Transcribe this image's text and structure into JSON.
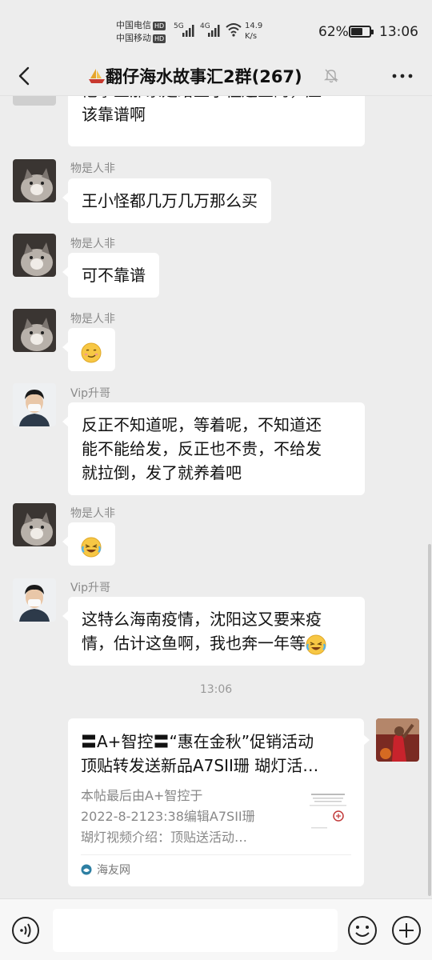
{
  "status": {
    "carrier1": "中国电信",
    "carrier2": "中国移动",
    "hd": "HD",
    "sig1": "5G",
    "sig2": "4G",
    "speed_value": "14.9",
    "speed_unit": "K/s",
    "battery_text": "62%",
    "battery_level": 0.62,
    "time": "13:06"
  },
  "header": {
    "title": "翻仔海水故事汇2群(267)",
    "title_icon": "boat-icon"
  },
  "messages": [
    {
      "sender": "",
      "text_lines": [
        "他拿鱼那家是给王小怪送鱼的，应",
        "该靠谱啊"
      ]
    },
    {
      "sender": "物是人非",
      "text": "王小怪都几万几万那么买"
    },
    {
      "sender": "物是人非",
      "text": "可不靠谱"
    },
    {
      "sender": "物是人非",
      "emoji": "smirk-emoji"
    },
    {
      "sender": "Vip升哥",
      "text_lines": [
        "反正不知道呢，等着呢，不知道还",
        "能不能给发，反正也不贵，不给发",
        "就拉倒，发了就养着吧"
      ]
    },
    {
      "sender": "物是人非",
      "emoji": "laughing-crying-emoji"
    },
    {
      "sender": "Vip升哥",
      "text_lines": [
        "这特么海南疫情，沈阳这又要来疫",
        "情，估计这鱼啊，我也奔一年等"
      ],
      "emoji": "laughing-crying-emoji"
    }
  ],
  "time_separator": "13:06",
  "link_card": {
    "title_line1": "〓A+智控〓“惠在金秋”促销活动",
    "title_line2": "顶贴转发送新品A7SII珊 瑚灯活…",
    "desc_line1": "本帖最后由A+智控于",
    "desc_line2": "2022-8-2123:38编辑A7SII珊",
    "desc_line3": "瑚灯视频介绍：顶贴送活动…",
    "source": "海友网"
  },
  "colors": {
    "background": "#ededed",
    "bubble": "#ffffff",
    "sender_name": "#8a8a8a"
  }
}
